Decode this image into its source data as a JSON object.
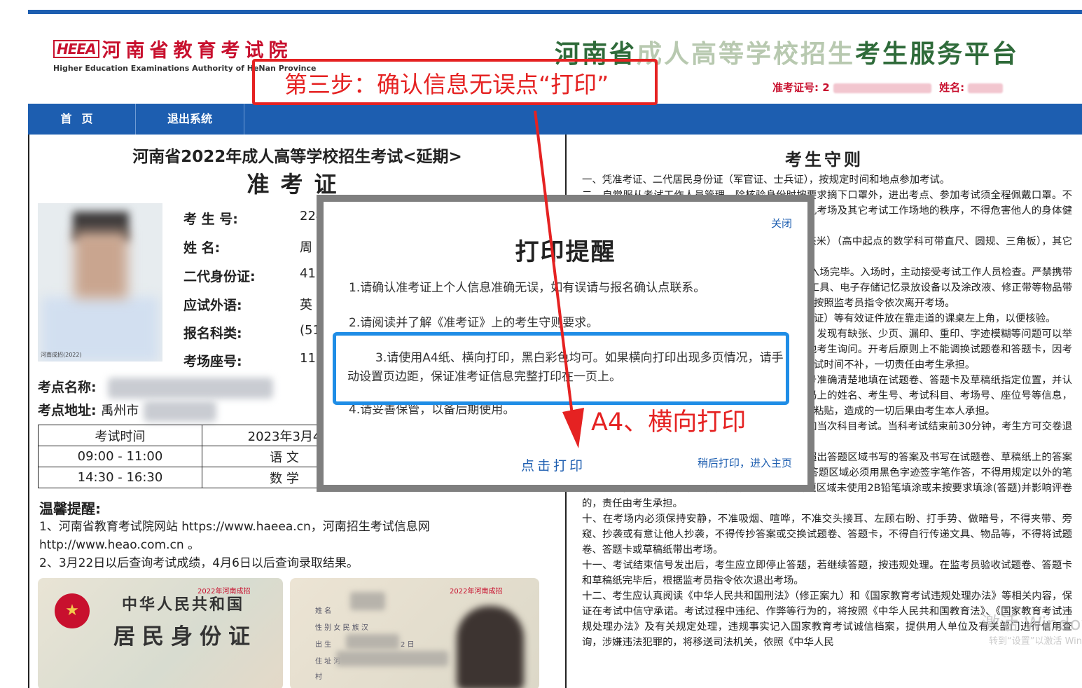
{
  "header": {
    "logo_mark": "HEEA",
    "logo_cn": "河南省教育考试院",
    "logo_en": "Higher Education Examinations Authority of HeNan Province",
    "platform_title_part1": "河南省",
    "platform_title_part2": "成人高等学校招生",
    "platform_title_part3": "考生服务平台",
    "admission_no_label": "准考证号: 2",
    "name_label": "姓名:"
  },
  "nav": {
    "home": "首页",
    "exit": "退出系统"
  },
  "card": {
    "title": "河南省2022年成人高等学校招生考试<延期>",
    "subtitle": "准考证",
    "photo_caption": "河南成招(2022)",
    "fields": [
      {
        "label": "考 生 号:",
        "value": "224"
      },
      {
        "label": "姓    名:",
        "value": "周"
      },
      {
        "label": "二代身份证:",
        "value": "41"
      },
      {
        "label": "应试外语:",
        "value": "英"
      },
      {
        "label": "报名科类:",
        "value": "(51"
      },
      {
        "label": "考场座号:",
        "value": "115"
      }
    ],
    "site_name_label": "考点名称:",
    "site_addr_label": "考点地址:",
    "site_addr_value": "禹州市",
    "table": {
      "header_time": "考试时间",
      "header_date": "2023年3月4",
      "rows": [
        {
          "time": "09:00 - 11:00",
          "subject": "语    文"
        },
        {
          "time": "14:30 - 16:30",
          "subject": "数    学"
        }
      ]
    },
    "tips_title": "温馨提醒:",
    "tips": [
      "1、河南省教育考试院网站 https://www.haeea.cn，河南招生考试信息网",
      "http://www.heao.com.cn 。",
      "2、3月22日以后查询考试成绩，4月6日以后查询录取结果。"
    ],
    "idcard_stamp": "2022年河南成招",
    "idcard_nation": "中华人民共和国",
    "idcard_title": "居民身份证",
    "idcard_fields": [
      "姓 名",
      "性 别  女    民 族  汉",
      "出 生",
      "住 址  河",
      "村"
    ],
    "idcard_date_suffix": "2 日"
  },
  "rules": {
    "title": "考生守则",
    "paragraphs": [
      "一、凭准考证、二代居民身份证（军官证、士兵证），按规定时间和地点参加考试。",
      "二、自觉服从考试工作人员管理，除核验身份时按要求摘下口罩外，进出考点、参加考试须全程佩戴口罩。不得以任何理由妨碍考试工作人员履行职责，不得扰乱考场及其它考试工作场地的秩序，不得危害他人的身体健康和生命安全。",
      "三、考生只准携带2B铅笔、黑色字迹签字笔（0.5毫米）（高中起点的数学科可带直尺、圆规、三角板），其它任何物品不准带入考场。",
      "四、考生在每科开考前20分钟进入考场，15分钟内入场完毕。入场时，主动接受考试工作人员检查。严禁携带各种无线通讯工具（移动电话、耳麦等）、各式计时工具、电子存储记忆录放设备以及涂改液、修正带等物品带入考场。考生入场后未经允许不得离开，考试结束后按照监考员指令依次离开考场。",
      "五、考生入场后，将准考证、身份证（军官证、士兵证）等有效证件放在靠走道的课桌左上角，以便核验。",
      "六、开考信号发出后，考生先检查试题卷、答题卡，发现有缺张、少页、漏印、重印、字迹模糊等问题可以举手询问；涉及试题内容的疑问，不得向监考员或其他考生询问。开考后原则上不能调换试题卷和答题卡，因考生自身原因导致的试题卷、答题卡污损等，耽误的考试时间不补，一切责任由考生承担。",
      "七、考生须在规定位置将本人姓名、考生号、座位号准确清楚地填在试题卷、答题卡及草稿纸指定位置，并认真核对条形码。考生拿到答题卡时应认真核对条形码上的姓名、考生号、考试科目、考场号、座位号等信息，确认无误后粘贴在答题卡规定位置。若不按要求填写粘贴，造成的一切后果由考生本人承担。",
      "八、开考信号发出后15分钟后迟到考生不得入场参加当次科目考试。当科考试结束前30分钟，考生方可交卷退场。",
      "九、严格按照答题卡题号所指示的答题区域作答，超出答题区域书写的答案及书写在试题卷、草稿纸上的答案无效。客观题答题区域必须用2B铅笔填涂，主观题答题区域必须用黑色字迹签字笔作答，不得用规定以外的笔和纸答题，不得在答题卡上做任何标记。客观题答题区域未使用2B铅笔填涂或未按要求填涂(答题)并影响评卷的，责任由考生承担。",
      "十、在考场内必须保持安静，不准吸烟、喧哗，不准交头接耳、左顾右盼、打手势、做暗号，不得夹带、旁窥、抄袭或有意让他人抄袭，不得传抄答案或交换试题卷、答题卡，不得自行传递文具、物品等，不得将试题卷、答题卡或草稿纸带出考场。",
      "十一、考试结束信号发出后，考生应立即停止答题，若继续答题，按违规处理。在监考员验收试题卷、答题卡和草稿纸完毕后，根据监考员指令依次退出考场。",
      "十二、考生应认真阅读《中华人民共和国刑法》（修正案九）和《国家教育考试违规处理办法》等相关内容，保证在考试中信守承诺。考试过程中违纪、作弊等行为的，将按照《中华人民共和国教育法》、《国家教育考试违规处理办法》及有关规定处理，违规事实记入国家教育考试诚信档案，提供用人单位及有关部门进行信用查询，涉嫌违法犯罪的，将移送司法机关，依照《中华人民"
    ]
  },
  "modal": {
    "close": "关闭",
    "title": "打印提醒",
    "lines": [
      "1.请确认准考证上个人信息准确无误，如有误请与报名确认点联系。",
      "2.请阅读并了解《准考证》上的考生守则要求。",
      "3.请使用A4纸、横向打印，黑白彩色均可。如果横向打印出现多页情况，请手动设置页边距，保证准考证信息完整打印在一页上。",
      "4.请妥善保管，以备后期使用。"
    ],
    "print_button": "点击打印",
    "later_link": "稍后打印，进入主页"
  },
  "annotations": {
    "step3": "第三步：确认信息无误点“打印”",
    "a4": "A4、横向打印"
  },
  "watermark": {
    "main": "激活 Windows",
    "sub": "转到“设置”以激活 Windows。"
  },
  "colors": {
    "nav_blue": "#1d5eb0",
    "brand_red": "#c8102e",
    "annotation_red": "#e52222",
    "highlight_blue": "#1f8de6"
  }
}
